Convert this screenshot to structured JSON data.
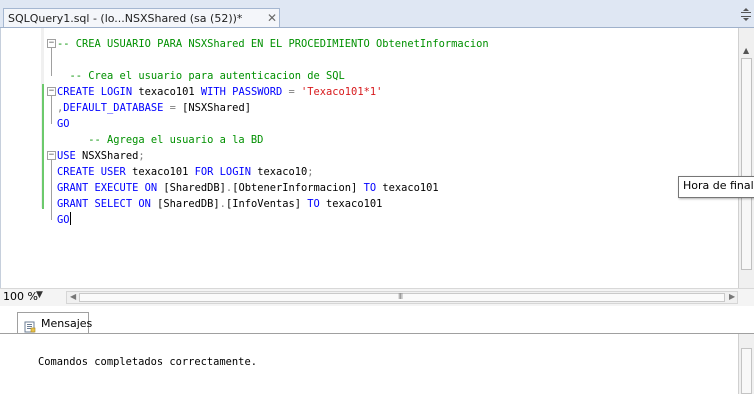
{
  "tab": {
    "title": "SQLQuery1.sql - (lo...NSXShared (sa (52))*",
    "close_glyph": "✕"
  },
  "editor": {
    "lines": [
      {
        "parts": [
          {
            "text": "-- CREA USUARIO PARA NSXShared EN EL PROCEDIMIENTO ObtenetInformacion",
            "cls": "cm"
          }
        ]
      },
      {
        "parts": []
      },
      {
        "parts": [
          {
            "text": "  -- Crea el usuario para autenticacion de SQL",
            "cls": "cm"
          }
        ]
      },
      {
        "parts": [
          {
            "text": "CREATE LOGIN",
            "cls": "kw"
          },
          {
            "text": " texaco101 ",
            "cls": "obj"
          },
          {
            "text": "WITH PASSWORD",
            "cls": "kw"
          },
          {
            "text": " = ",
            "cls": "gray"
          },
          {
            "text": "'Texaco101*1'",
            "cls": "str"
          }
        ]
      },
      {
        "parts": [
          {
            "text": ",",
            "cls": "gray"
          },
          {
            "text": "DEFAULT_DATABASE",
            "cls": "kw"
          },
          {
            "text": " = ",
            "cls": "gray"
          },
          {
            "text": "[NSXShared]",
            "cls": "obj"
          }
        ]
      },
      {
        "parts": [
          {
            "text": "GO",
            "cls": "kw"
          }
        ]
      },
      {
        "parts": [
          {
            "text": "     -- Agrega el usuario a la BD",
            "cls": "cm"
          }
        ]
      },
      {
        "parts": [
          {
            "text": "USE",
            "cls": "kw"
          },
          {
            "text": " NSXShared",
            "cls": "obj"
          },
          {
            "text": ";",
            "cls": "gray"
          }
        ]
      },
      {
        "parts": [
          {
            "text": "CREATE USER",
            "cls": "kw"
          },
          {
            "text": " texaco101 ",
            "cls": "obj"
          },
          {
            "text": "FOR LOGIN",
            "cls": "kw"
          },
          {
            "text": " texaco10",
            "cls": "obj"
          },
          {
            "text": ";",
            "cls": "gray"
          }
        ]
      },
      {
        "parts": [
          {
            "text": "GRANT EXECUTE ON",
            "cls": "kw"
          },
          {
            "text": " [SharedDB]",
            "cls": "obj"
          },
          {
            "text": ".",
            "cls": "gray"
          },
          {
            "text": "[ObtenerInformacion] ",
            "cls": "obj"
          },
          {
            "text": "TO",
            "cls": "kw"
          },
          {
            "text": " texaco101",
            "cls": "obj"
          }
        ]
      },
      {
        "parts": [
          {
            "text": "GRANT SELECT ON",
            "cls": "kw"
          },
          {
            "text": " [SharedDB]",
            "cls": "obj"
          },
          {
            "text": ".",
            "cls": "gray"
          },
          {
            "text": "[InfoVentas] ",
            "cls": "obj"
          },
          {
            "text": "TO",
            "cls": "kw"
          },
          {
            "text": " texaco101",
            "cls": "obj"
          }
        ]
      },
      {
        "parts": [
          {
            "text": "GO",
            "cls": "kw"
          }
        ],
        "caret": true
      }
    ]
  },
  "tooltip": {
    "text": "Hora de finaliz"
  },
  "zoom": {
    "value": "100 %",
    "arrow": "▼"
  },
  "hscroll": {
    "grip": "III"
  },
  "results": {
    "tab_label": "Mensajes",
    "message": "Comandos completados correctamente."
  },
  "colors": {
    "keyword": "#0000ff",
    "string": "#d7191c",
    "comment": "#009000",
    "operator": "#808080"
  },
  "icons": {
    "tab_close": "close-icon",
    "messages": "messages-icon",
    "split": "split-icon"
  }
}
